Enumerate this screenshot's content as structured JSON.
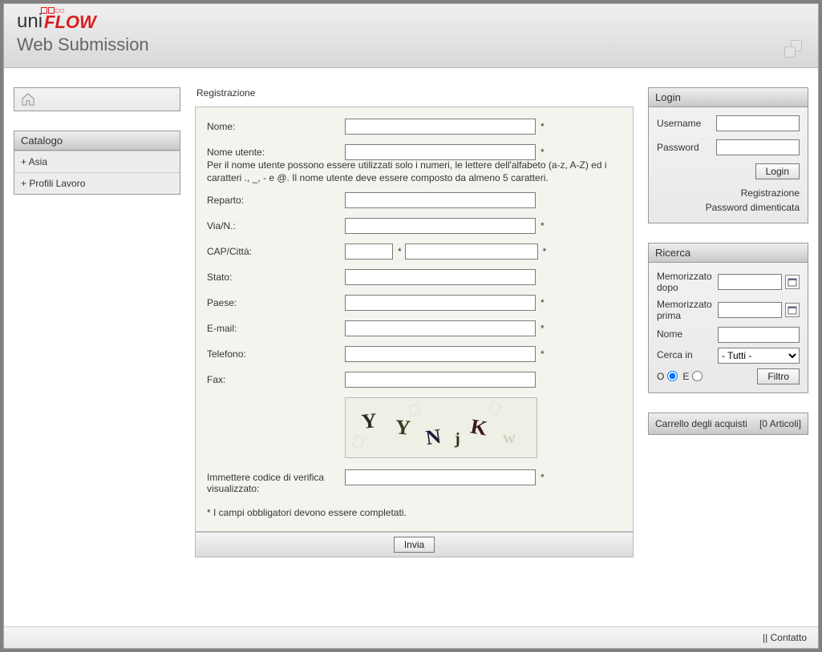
{
  "header": {
    "logo_part1": "uni",
    "logo_part2": "FLOW",
    "subtitle": "Web Submission"
  },
  "sidebar": {
    "catalog_title": "Catalogo",
    "items": [
      {
        "label": "+ Asia"
      },
      {
        "label": "+ Profili Lavoro"
      }
    ]
  },
  "form": {
    "title": "Registrazione",
    "nome_label": "Nome:",
    "nome_utente_label": "Nome utente:",
    "nome_utente_hint": "Per il nome utente possono essere utilizzati solo i numeri, le lettere dell'alfabeto (a-z, A-Z) ed i caratteri ., _, - e @. Il nome utente deve essere composto da almeno 5 caratteri.",
    "reparto_label": "Reparto:",
    "via_label": "Via/N.:",
    "cap_label": "CAP/Città:",
    "stato_label": "Stato:",
    "paese_label": "Paese:",
    "email_label": "E-mail:",
    "telefono_label": "Telefono:",
    "fax_label": "Fax:",
    "captcha_label": "Immettere codice di verifica visualizzato:",
    "captcha_text": "YYNjK",
    "required_note": "*   I campi obbligatori devono essere completati.",
    "submit_label": "Invia"
  },
  "login": {
    "title": "Login",
    "username_label": "Username",
    "password_label": "Password",
    "login_button": "Login",
    "register_link": "Registrazione",
    "forgot_link": "Password dimenticata"
  },
  "search": {
    "title": "Ricerca",
    "after_label": "Memorizzato dopo",
    "before_label": "Memorizzato prima",
    "name_label": "Nome",
    "searchin_label": "Cerca in",
    "searchin_option": "- Tutti -",
    "radio_o": "O",
    "radio_e": "E",
    "filter_button": "Filtro"
  },
  "cart": {
    "label": "Carrello degli acquisti",
    "count": "[0 Articoli]"
  },
  "footer": {
    "contact": "Contatto"
  }
}
